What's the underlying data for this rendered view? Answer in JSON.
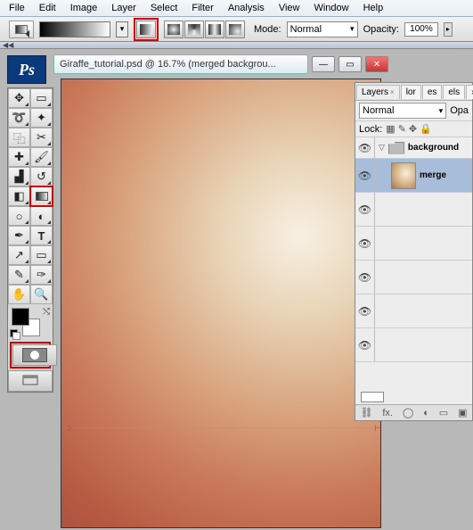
{
  "menu": {
    "items": [
      "File",
      "Edit",
      "Image",
      "Layer",
      "Select",
      "Filter",
      "Analysis",
      "View",
      "Window",
      "Help"
    ]
  },
  "options": {
    "mode_label": "Mode:",
    "mode_value": "Normal",
    "opacity_label": "Opacity:",
    "opacity_value": "100%"
  },
  "collapse_glyph": "◀◀",
  "ps_badge": "Ps",
  "document": {
    "title": "Giraffe_tutorial.psd @ 16.7% (merged backgrou...",
    "min": "—",
    "max": "▭",
    "close": "✕"
  },
  "layers_panel": {
    "tabs": {
      "layers": "Layers",
      "t2": "lor",
      "t3": "es",
      "t4": "els",
      "t5": "›"
    },
    "blend_mode": "Normal",
    "opacity_label": "Opa",
    "lock_label": "Lock:",
    "folder_name": "background",
    "layer_name": "merge",
    "footer": {
      "link": "⛓",
      "fx": "fx.",
      "mask": "◯",
      "adj": "◐",
      "folder": "▭",
      "new": "▣"
    }
  },
  "tool_icons": {
    "move": "✥",
    "marquee": "▭",
    "lasso": "➰",
    "wand": "✦",
    "crop": "⿻",
    "slice": "✂",
    "heal": "✚",
    "brush": "🖌",
    "stamp": "▟",
    "history": "↺",
    "eraser": "◧",
    "gradient": "▭",
    "blur": "○",
    "dodge": "◐",
    "pen": "✒",
    "type": "T",
    "path": "↗",
    "shape": "▭",
    "notes": "✎",
    "eyedrop": "✑",
    "hand": "✋",
    "zoom": "🔍"
  }
}
